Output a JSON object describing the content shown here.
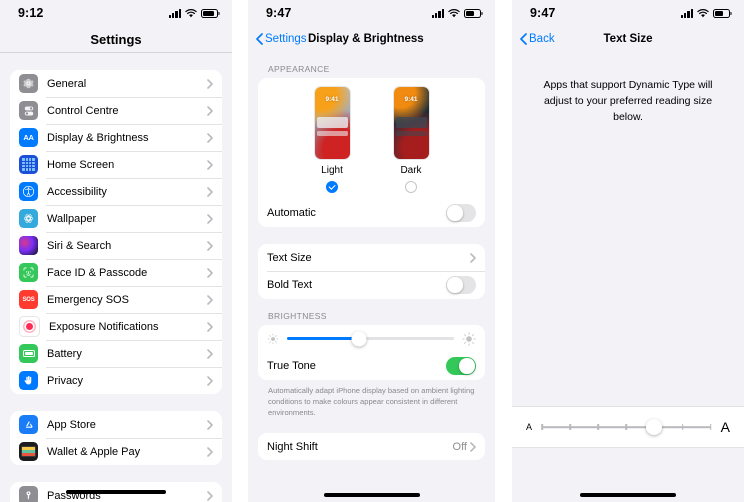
{
  "panels": {
    "settings": {
      "status": {
        "time": "9:12",
        "battery_level": 72
      },
      "title": "Settings",
      "groups": [
        {
          "rows": [
            {
              "label": "General",
              "icon": "gear-icon",
              "chevron": true
            },
            {
              "label": "Control Centre",
              "icon": "control-centre-icon",
              "chevron": true
            },
            {
              "label": "Display & Brightness",
              "icon": "display-brightness-icon",
              "icon_text": "AA",
              "chevron": true
            },
            {
              "label": "Home Screen",
              "icon": "home-screen-icon",
              "chevron": true
            },
            {
              "label": "Accessibility",
              "icon": "accessibility-icon",
              "chevron": true
            },
            {
              "label": "Wallpaper",
              "icon": "wallpaper-icon",
              "chevron": true
            },
            {
              "label": "Siri & Search",
              "icon": "siri-icon",
              "chevron": true
            },
            {
              "label": "Face ID & Passcode",
              "icon": "face-id-icon",
              "chevron": true
            },
            {
              "label": "Emergency SOS",
              "icon": "emergency-sos-icon",
              "icon_text": "SOS",
              "chevron": true
            },
            {
              "label": "Exposure Notifications",
              "icon": "exposure-notifications-icon",
              "chevron": true
            },
            {
              "label": "Battery",
              "icon": "battery-icon",
              "chevron": true
            },
            {
              "label": "Privacy",
              "icon": "privacy-icon",
              "chevron": true
            }
          ]
        },
        {
          "rows": [
            {
              "label": "App Store",
              "icon": "app-store-icon",
              "chevron": true
            },
            {
              "label": "Wallet & Apple Pay",
              "icon": "wallet-icon",
              "chevron": true
            }
          ]
        },
        {
          "rows": [
            {
              "label": "Passwords",
              "icon": "passwords-icon",
              "chevron": true
            }
          ]
        }
      ]
    },
    "display": {
      "status": {
        "time": "9:47",
        "battery_level": 55
      },
      "back_label": "Settings",
      "title": "Display & Brightness",
      "appearance": {
        "header": "APPEARANCE",
        "options": [
          {
            "name": "Light",
            "selected": true
          },
          {
            "name": "Dark",
            "selected": false
          }
        ],
        "preview_time": "9:41",
        "automatic_label": "Automatic",
        "automatic_on": false
      },
      "text_group": {
        "text_size_label": "Text Size",
        "bold_text_label": "Bold Text",
        "bold_text_on": false
      },
      "brightness": {
        "header": "BRIGHTNESS",
        "value_percent": 43,
        "true_tone_label": "True Tone",
        "true_tone_on": true,
        "true_tone_note": "Automatically adapt iPhone display based on ambient lighting conditions to make colours appear consistent in different environments."
      },
      "night_shift": {
        "label": "Night Shift",
        "value": "Off"
      }
    },
    "text_size": {
      "status": {
        "time": "9:47",
        "battery_level": 55
      },
      "back_label": "Back",
      "title": "Text Size",
      "description": "Apps that support Dynamic Type will adjust to your preferred reading size below.",
      "slider": {
        "min_label": "A",
        "max_label": "A",
        "steps": 7,
        "value": 5
      }
    }
  },
  "colors": {
    "accent": "#007aff",
    "toggle_on": "#34c759",
    "group_bg": "#ffffff",
    "page_bg": "#f2f2f7",
    "secondary_text": "#8e8e93"
  }
}
